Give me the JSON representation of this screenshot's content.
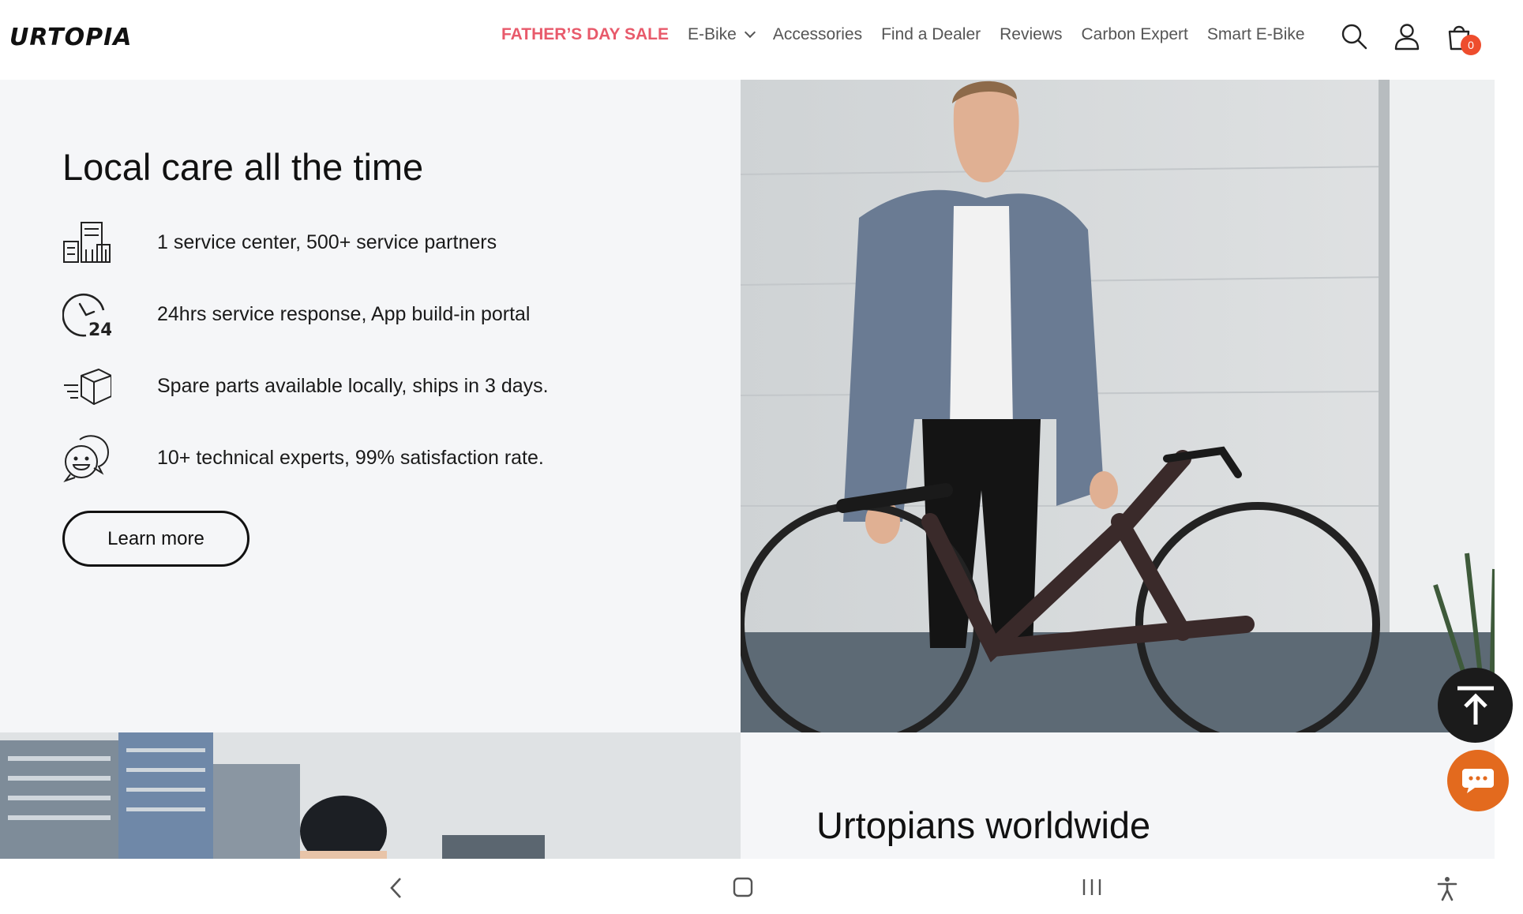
{
  "header": {
    "logo": "URTOPIA",
    "nav": [
      {
        "label": "FATHER’S DAY SALE",
        "highlight": true
      },
      {
        "label": "E-Bike",
        "has_dropdown": true
      },
      {
        "label": "Accessories"
      },
      {
        "label": "Find a Dealer"
      },
      {
        "label": "Reviews"
      },
      {
        "label": "Carbon Expert"
      },
      {
        "label": "Smart E-Bike"
      }
    ],
    "icons": [
      "search-icon",
      "account-icon",
      "cart-icon"
    ],
    "cart_count": "0"
  },
  "care_section": {
    "title": "Local care all the time",
    "features": [
      {
        "icon": "service-buildings-icon",
        "text": "1 service center, 500+ service partners"
      },
      {
        "icon": "clock-24-icon",
        "text": "24hrs service response, App build-in portal"
      },
      {
        "icon": "shipping-box-icon",
        "text": "Spare parts available locally, ships in 3 days."
      },
      {
        "icon": "experts-chat-icon",
        "text": "10+ technical experts, 99% satisfaction rate."
      }
    ],
    "button_label": "Learn more"
  },
  "worldwide_section": {
    "title": "Urtopians worldwide"
  },
  "floating": {
    "to_top_icon": "arrow-to-top-icon",
    "chat_icon": "chat-bubble-icon"
  },
  "system_nav": [
    "back-icon",
    "home-icon",
    "recents-icon",
    "accessibility-icon"
  ],
  "colors": {
    "sale": "#e85a6b",
    "cart_badge": "#ee4d2d",
    "chat": "#e36a1e",
    "panel_bg": "#f5f6f8"
  }
}
